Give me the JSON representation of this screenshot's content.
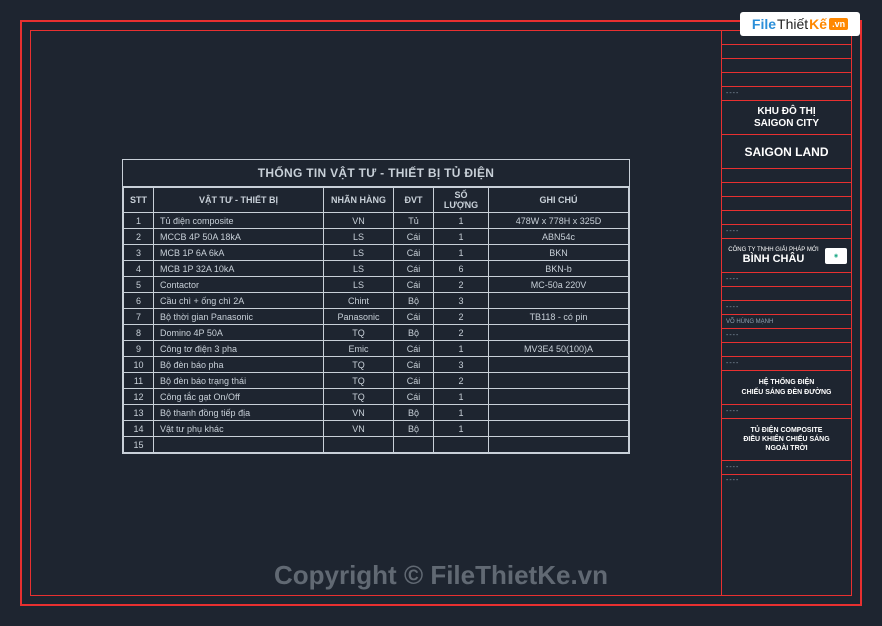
{
  "watermark": {
    "site_prefix": "File",
    "site_mid": "Thiết",
    "site_accent": "Kế",
    "site_tld": ".vn",
    "copyright": "Copyright © FileThietKe.vn"
  },
  "table": {
    "title": "THỐNG TIN VẬT TƯ - THIẾT BỊ TỦ ĐIỆN",
    "headers": {
      "stt": "STT",
      "vt": "VẬT TƯ - THIẾT BỊ",
      "nh": "NHÃN HÀNG",
      "dvt": "ĐVT",
      "sl": "SỐ LƯỢNG",
      "gc": "GHI CHÚ"
    },
    "rows": [
      {
        "stt": "1",
        "vt": "Tủ điện composite",
        "nh": "VN",
        "dvt": "Tủ",
        "sl": "1",
        "gc": "478W x 778H x 325D"
      },
      {
        "stt": "2",
        "vt": "MCCB 4P 50A 18kA",
        "nh": "LS",
        "dvt": "Cái",
        "sl": "1",
        "gc": "ABN54c"
      },
      {
        "stt": "3",
        "vt": "MCB 1P 6A 6kA",
        "nh": "LS",
        "dvt": "Cái",
        "sl": "1",
        "gc": "BKN"
      },
      {
        "stt": "4",
        "vt": "MCB 1P 32A 10kA",
        "nh": "LS",
        "dvt": "Cái",
        "sl": "6",
        "gc": "BKN-b"
      },
      {
        "stt": "5",
        "vt": "Contactor",
        "nh": "LS",
        "dvt": "Cái",
        "sl": "2",
        "gc": "MC-50a 220V"
      },
      {
        "stt": "6",
        "vt": "Cầu chì + ống chì 2A",
        "nh": "Chint",
        "dvt": "Bộ",
        "sl": "3",
        "gc": ""
      },
      {
        "stt": "7",
        "vt": "Bộ thời gian Panasonic",
        "nh": "Panasonic",
        "dvt": "Cái",
        "sl": "2",
        "gc": "TB118 - có pin"
      },
      {
        "stt": "8",
        "vt": "Domino 4P 50A",
        "nh": "TQ",
        "dvt": "Bộ",
        "sl": "2",
        "gc": ""
      },
      {
        "stt": "9",
        "vt": "Công tơ điện 3 pha",
        "nh": "Emic",
        "dvt": "Cái",
        "sl": "1",
        "gc": "MV3E4 50(100)A"
      },
      {
        "stt": "10",
        "vt": "Bộ đèn báo pha",
        "nh": "TQ",
        "dvt": "Cái",
        "sl": "3",
        "gc": ""
      },
      {
        "stt": "11",
        "vt": "Bộ đèn báo trạng thái",
        "nh": "TQ",
        "dvt": "Cái",
        "sl": "2",
        "gc": ""
      },
      {
        "stt": "12",
        "vt": "Công tắc gạt On/Off",
        "nh": "TQ",
        "dvt": "Cái",
        "sl": "1",
        "gc": ""
      },
      {
        "stt": "13",
        "vt": "Bộ thanh đồng tiếp địa",
        "nh": "VN",
        "dvt": "Bộ",
        "sl": "1",
        "gc": ""
      },
      {
        "stt": "14",
        "vt": "Vật tư phụ khác",
        "nh": "VN",
        "dvt": "Bộ",
        "sl": "1",
        "gc": ""
      },
      {
        "stt": "15",
        "vt": "",
        "nh": "",
        "dvt": "",
        "sl": "",
        "gc": ""
      }
    ]
  },
  "titleblock": {
    "dash": "----",
    "project_line1": "KHU ĐÔ THỊ",
    "project_line2": "SAIGON CITY",
    "owner": "SAIGON LAND",
    "company_small": "CÔNG TY TNHH GIẢI PHÁP MỚI",
    "company_big": "BÌNH CHÂU",
    "designer": "VÕ HÙNG MẠNH",
    "system_line1": "HỆ THỐNG ĐIỆN",
    "system_line2": "CHIẾU SÁNG ĐÈN ĐƯỜNG",
    "sheet_line1": "TỦ ĐIỆN COMPOSITE",
    "sheet_line2": "ĐIỀU KHIỂN CHIẾU SÁNG",
    "sheet_line3": "NGOÀI TRỜI"
  }
}
